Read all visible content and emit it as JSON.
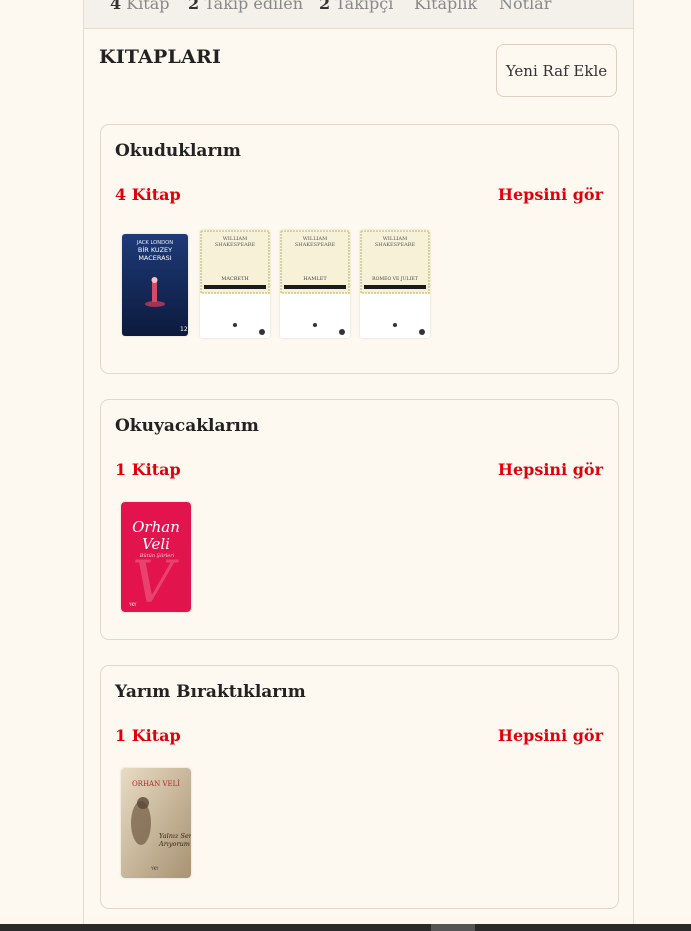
{
  "tabs": [
    {
      "count": "4",
      "label": "Kitap"
    },
    {
      "count": "2",
      "label": "Takip edilen"
    },
    {
      "count": "2",
      "label": "Takipçi"
    },
    {
      "count": "",
      "label": "Kitaplık"
    },
    {
      "count": "",
      "label": "Notlar"
    }
  ],
  "section": {
    "title": "KITAPLARI",
    "add_shelf_label": "Yeni Raf Ekle"
  },
  "shelves": [
    {
      "name": "Okuduklarım",
      "count_label": "4 Kitap",
      "see_all_label": "Hepsini gör",
      "books": [
        {
          "cover_author": "JACK LONDON",
          "cover_title": "BİR KUZEY MACERASI"
        },
        {
          "cover_author": "WILLIAM SHAKESPEARE",
          "cover_title": "MACBETH"
        },
        {
          "cover_author": "WILLIAM SHAKESPEARE",
          "cover_title": "HAMLET"
        },
        {
          "cover_author": "WILLIAM SHAKESPEARE",
          "cover_title": "ROMEO VE JULIET"
        }
      ]
    },
    {
      "name": "Okuyacaklarım",
      "count_label": "1 Kitap",
      "see_all_label": "Hepsini gör",
      "books": [
        {
          "cover_author": "Orhan Veli",
          "cover_title": "Bütün Şiirleri"
        }
      ]
    },
    {
      "name": "Yarım Bıraktıklarım",
      "count_label": "1 Kitap",
      "see_all_label": "Hepsini gör",
      "books": [
        {
          "cover_author": "ORHAN VELİ",
          "cover_title": "Yalnız Seni Arıyorum"
        }
      ]
    }
  ],
  "colors": {
    "accent": "#e0000a",
    "background": "#fdf9f1"
  }
}
